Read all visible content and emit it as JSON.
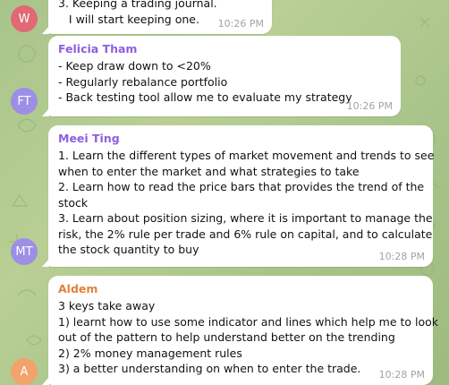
{
  "colors": {
    "wallpaper": "#a8c48b",
    "bubble": "#ffffff",
    "timestamp": "#a3a3a3"
  },
  "messages": [
    {
      "avatar_initials": "W",
      "avatar_color": "#e06a73",
      "sender": "",
      "sender_color": "",
      "lines": [
        "3. Keeping a trading journal.",
        "   I will start keeping one."
      ],
      "time": "10:26 PM"
    },
    {
      "avatar_initials": "FT",
      "avatar_color": "#9d8ee6",
      "sender": "Felicia Tham",
      "sender_color": "#8e5fe0",
      "lines": [
        "- Keep draw down to <20%",
        "- Regularly rebalance portfolio",
        "- Back testing tool allow me to evaluate my strategy"
      ],
      "time": "10:26 PM"
    },
    {
      "avatar_initials": "MT",
      "avatar_color": "#9d8ee6",
      "sender": "Meei Ting",
      "sender_color": "#8e5fe0",
      "lines": [
        "1. Learn the different types of market movement and trends to see",
        "when to enter the market and what strategies to take",
        "2. Learn how to read the price bars that provides the trend of the",
        "stock",
        "3. Learn about position sizing, where it is important to manage the",
        "risk, the 2% rule per trade and 6% rule on capital, and to calculate",
        "the stock quantity to buy"
      ],
      "time": "10:28 PM"
    },
    {
      "avatar_initials": "A",
      "avatar_color": "#f2a36b",
      "sender": "Aldem",
      "sender_color": "#e0823d",
      "lines": [
        "3 keys take away",
        "1) learnt how to use some indicator and lines which help me to look",
        "out of the pattern to help understand better on the trending",
        "2) 2% money management rules",
        "3) a better understanding on when to enter the trade."
      ],
      "time": "10:28 PM"
    }
  ]
}
